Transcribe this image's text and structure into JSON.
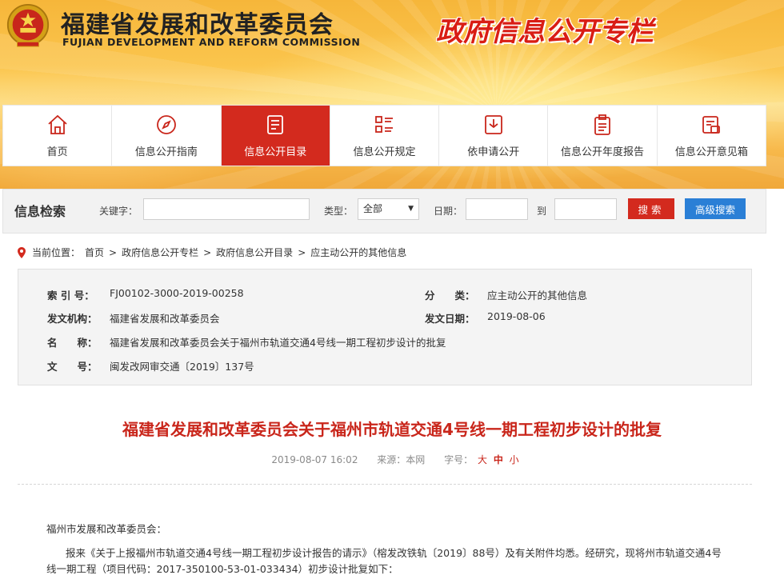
{
  "header": {
    "org_name": "福建省发展和改革委员会",
    "org_name_en": "FUJIAN DEVELOPMENT AND REFORM COMMISSION",
    "slogan": "政府信息公开专栏"
  },
  "nav": [
    {
      "label": "首页",
      "icon": "home-icon"
    },
    {
      "label": "信息公开指南",
      "icon": "compass-icon"
    },
    {
      "label": "信息公开目录",
      "icon": "document-list-icon",
      "active": true
    },
    {
      "label": "信息公开规定",
      "icon": "list-rules-icon"
    },
    {
      "label": "依申请公开",
      "icon": "inbox-download-icon"
    },
    {
      "label": "信息公开年度报告",
      "icon": "clipboard-report-icon"
    },
    {
      "label": "信息公开意见箱",
      "icon": "feedback-box-icon"
    }
  ],
  "search": {
    "title": "信息检索",
    "keyword_label": "关键字：",
    "keyword_value": "",
    "type_label": "类型：",
    "type_value": "全部",
    "date_label": "日期：",
    "date_from": "",
    "to_label": "到",
    "date_to": "",
    "search_button": "搜索",
    "advanced_button": "高级搜索"
  },
  "breadcrumb": {
    "prefix": "当前位置：",
    "items": [
      "首页",
      "政府信息公开专栏",
      "政府信息公开目录",
      "应主动公开的其他信息"
    ],
    "separator": ">"
  },
  "info": {
    "index_key": "索 引 号：",
    "index_val": "FJ00102-3000-2019-00258",
    "category_key": "分　　类：",
    "category_val": "应主动公开的其他信息",
    "issuer_key": "发文机构：",
    "issuer_val": "福建省发展和改革委员会",
    "date_key": "发文日期：",
    "date_val": "2019-08-06",
    "name_key": "名　　称：",
    "name_val": "福建省发展和改革委员会关于福州市轨道交通4号线一期工程初步设计的批复",
    "docno_key": "文　　号：",
    "docno_val": "闽发改网审交通〔2019〕137号"
  },
  "article": {
    "title": "福建省发展和改革委员会关于福州市轨道交通4号线一期工程初步设计的批复",
    "datetime": "2019-08-07 16:02",
    "source": "来源：本网",
    "font_label": "字号：",
    "font_big": "大",
    "font_mid": "中",
    "font_small": "小",
    "salutation": "福州市发展和改革委员会：",
    "paragraph1": "报来《关于上报福州市轨道交通4号线一期工程初步设计报告的请示》（榕发改铁轨〔2019〕88号）及有关附件均悉。经研究，现将州市轨道交通4号线一期工程（项目代码：2017-350100-53-01-033434）初步设计批复如下："
  }
}
